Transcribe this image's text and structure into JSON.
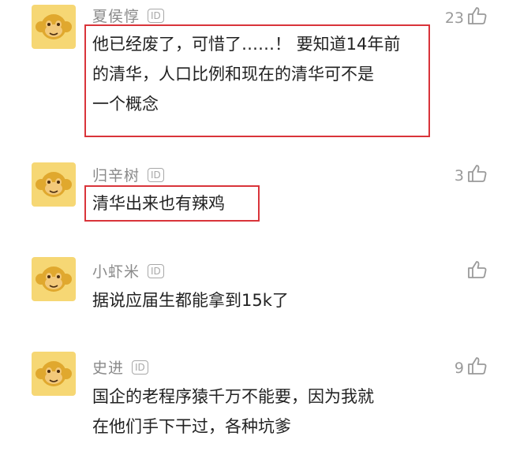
{
  "comments": [
    {
      "username": "夏侯惇",
      "id_badge": "ID",
      "text_lines": [
        "他已经废了，可惜了……！ 要知道14年前",
        "的清华，人口比例和现在的清华可不是",
        "一个概念"
      ],
      "likes": "23",
      "highlighted": true
    },
    {
      "username": "归辛树",
      "id_badge": "ID",
      "text_lines": [
        "清华出来也有辣鸡"
      ],
      "likes": "3",
      "highlighted": true
    },
    {
      "username": "小虾米",
      "id_badge": "ID",
      "text_lines": [
        "据说应届生都能拿到15k了"
      ],
      "likes": "",
      "highlighted": false
    },
    {
      "username": "史进",
      "id_badge": "ID",
      "text_lines": [
        "国企的老程序猿千万不能要，因为我就",
        "在他们手下干过，各种坑爹"
      ],
      "likes": "9",
      "highlighted": false
    }
  ],
  "colors": {
    "avatar_bg": "#f6d774",
    "monkey_face": "#e0a82e",
    "highlight_border": "#d9343a",
    "username": "#8a8a8a"
  },
  "icons": {
    "avatar": "monkey-avatar-icon",
    "like": "thumbs-up-icon",
    "id": "id-badge-icon"
  }
}
